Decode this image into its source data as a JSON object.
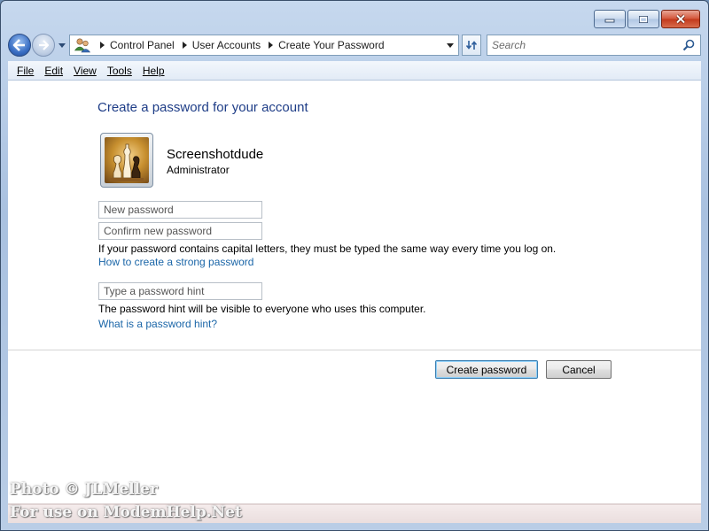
{
  "window": {
    "caption_buttons": [
      {
        "name": "minimize-button",
        "icon": "minimize-icon"
      },
      {
        "name": "maximize-button",
        "icon": "maximize-icon"
      },
      {
        "name": "close-button",
        "icon": "close-icon"
      }
    ]
  },
  "nav": {
    "back_icon": "back-arrow-icon",
    "forward_icon": "forward-arrow-icon",
    "breadcrumbs": [
      "Control Panel",
      "User Accounts",
      "Create Your Password"
    ],
    "search_placeholder": "Search"
  },
  "menu": {
    "items": [
      "File",
      "Edit",
      "View",
      "Tools",
      "Help"
    ]
  },
  "page": {
    "title": "Create a password for your account",
    "user": {
      "name": "Screenshotdude",
      "role": "Administrator"
    },
    "fields": {
      "new_password_placeholder": "New password",
      "confirm_password_placeholder": "Confirm new password",
      "hint_placeholder": "Type a password hint"
    },
    "caps_notice": "If your password contains capital letters, they must be typed the same way every time you log on.",
    "strong_password_link": "How to create a strong password",
    "hint_notice": "The password hint will be visible to everyone who uses this computer.",
    "hint_link": "What is a password hint?",
    "buttons": {
      "create": "Create password",
      "cancel": "Cancel"
    }
  },
  "watermark": {
    "line1": "Photo © JLMeller",
    "line2": "For use on ModemHelp.Net"
  },
  "colors": {
    "title": "#1e3d87",
    "link": "#1b66a8",
    "close": "#c2391c"
  }
}
